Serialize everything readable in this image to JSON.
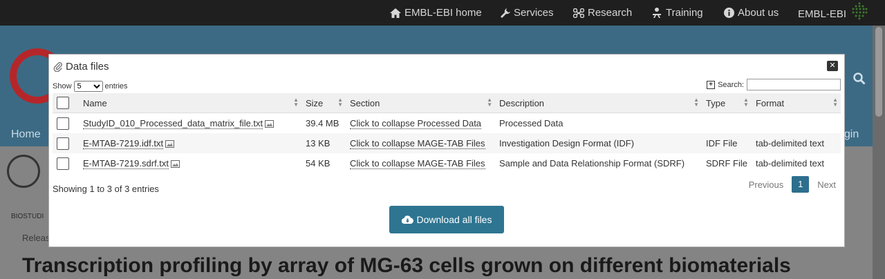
{
  "topnav": {
    "items": [
      {
        "label": "EMBL-EBI home",
        "icon": "home-icon"
      },
      {
        "label": "Services",
        "icon": "wrench-icon"
      },
      {
        "label": "Research",
        "icon": "research-icon"
      },
      {
        "label": "Training",
        "icon": "training-icon"
      },
      {
        "label": "About us",
        "icon": "info-icon"
      }
    ],
    "brand": "EMBL-EBI"
  },
  "background": {
    "home": "Home",
    "login": "ogin",
    "breadcrumb": "BIOSTUDI",
    "release": "Releas",
    "title": "Transcription profiling by array of MG-63 cells grown on different biomaterials"
  },
  "modal": {
    "title": "Data files",
    "close": "✕",
    "length": {
      "show": "Show",
      "value": "5",
      "entries": "entries"
    },
    "search_label": "Search:",
    "columns": [
      "Name",
      "Size",
      "Section",
      "Description",
      "Type",
      "Format"
    ],
    "rows": [
      {
        "name": "StudyID_010_Processed_data_matrix_file.txt",
        "size": "39.4 MB",
        "section": "Click to collapse Processed Data",
        "description": "Processed Data",
        "type": "",
        "format": ""
      },
      {
        "name": "E-MTAB-7219.idf.txt",
        "size": "13 KB",
        "section": "Click to collapse MAGE-TAB Files",
        "description": "Investigation Design Format (IDF)",
        "type": "IDF File",
        "format": "tab-delimited text"
      },
      {
        "name": "E-MTAB-7219.sdrf.txt",
        "size": "54 KB",
        "section": "Click to collapse MAGE-TAB Files",
        "description": "Sample and Data Relationship Format (SDRF)",
        "type": "SDRF File",
        "format": "tab-delimited text"
      }
    ],
    "info": "Showing 1 to 3 of 3 entries",
    "pagination": {
      "previous": "Previous",
      "current": "1",
      "next": "Next"
    },
    "download_button": "Download all files"
  },
  "colors": {
    "accent": "#2e7591",
    "topbar": "#1f1f1f"
  }
}
